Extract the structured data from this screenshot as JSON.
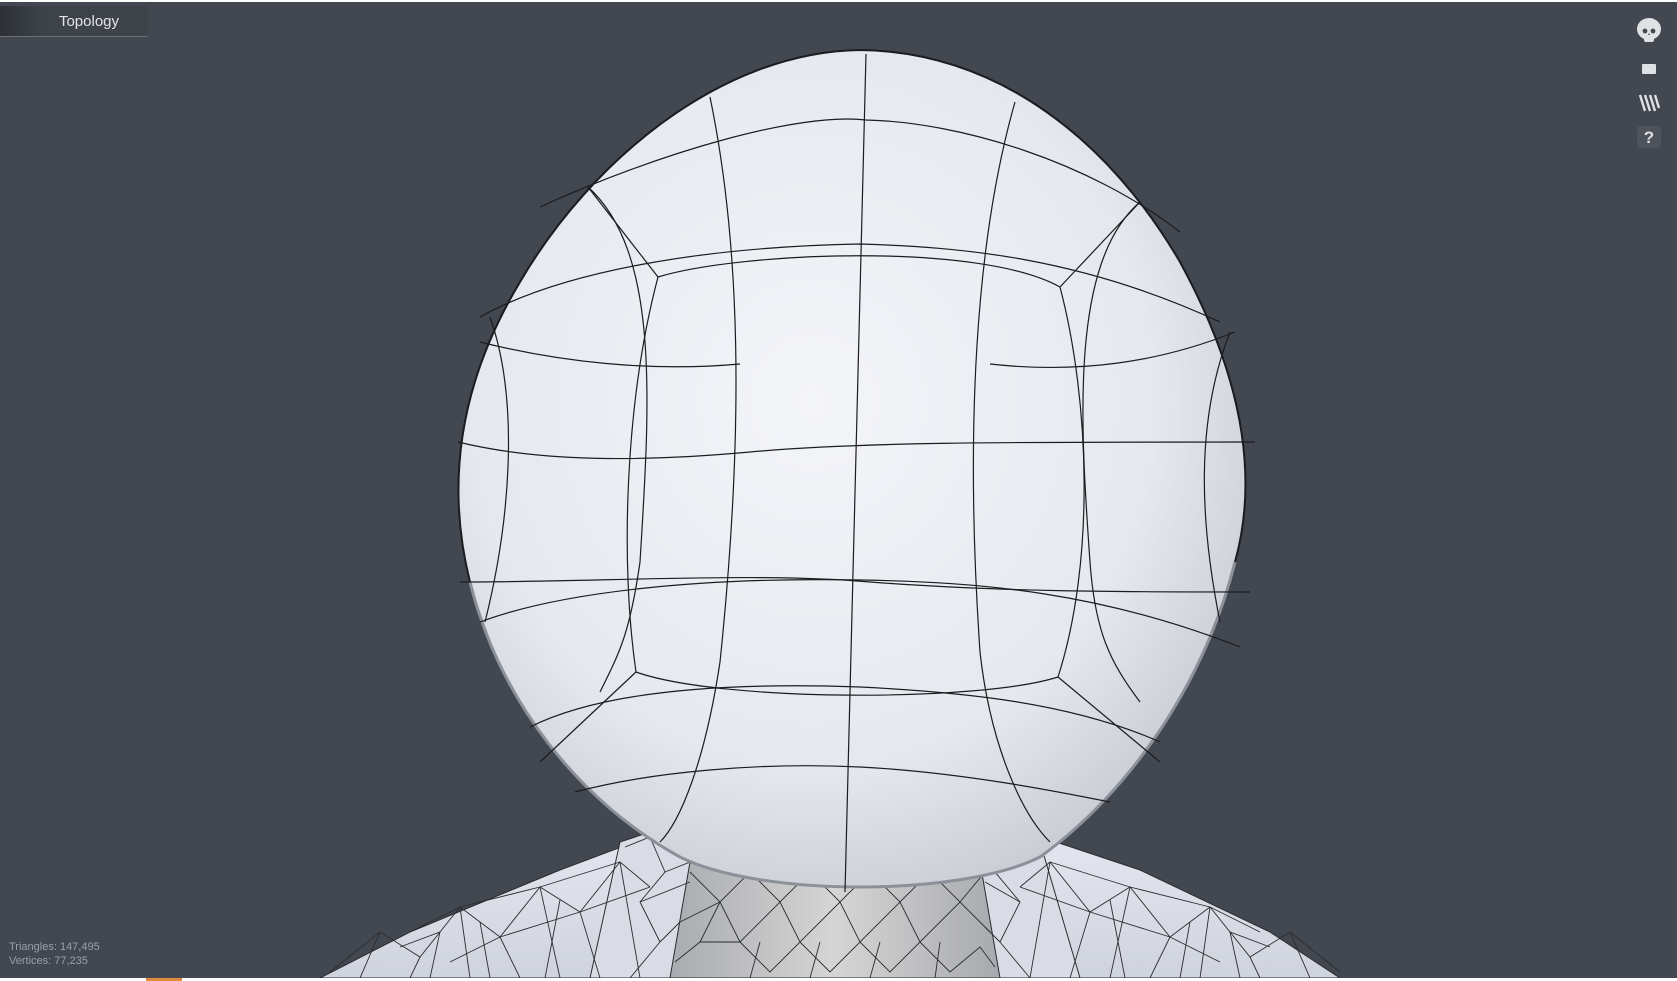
{
  "viewport": {
    "tab_label": "Topology",
    "background_color": "#434850"
  },
  "toolbar": {
    "tools": [
      {
        "name": "skull-icon"
      },
      {
        "name": "display-mode-icon"
      },
      {
        "name": "wireframe-icon"
      },
      {
        "name": "help-icon",
        "label": "?"
      }
    ]
  },
  "stats": {
    "triangles": "Triangles: 147,495",
    "vertices": "Vertices: 77,235"
  },
  "colors": {
    "accent": "#e08a3c",
    "mesh_fill": "#eceef3",
    "wire": "#1a1c20"
  }
}
